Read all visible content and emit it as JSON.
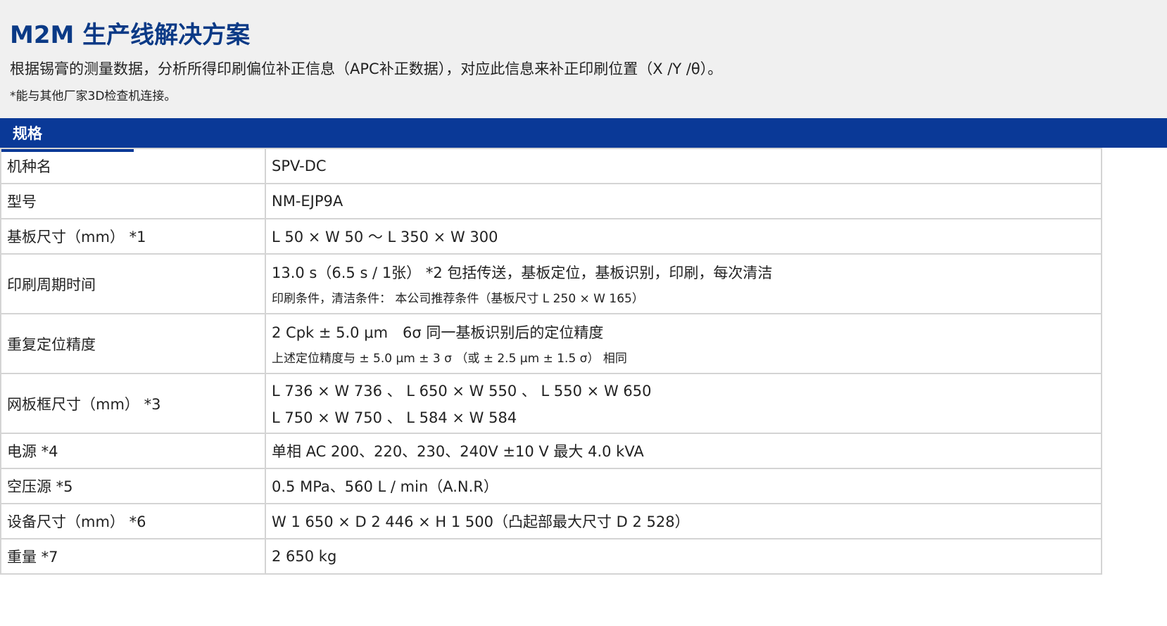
{
  "header": {
    "title": "M2M 生产线解决方案",
    "description": "根据锡膏的测量数据，分析所得印刷偏位补正信息（APC补正数据），对应此信息来补正印刷位置（X /Y /θ）。",
    "note": "*能与其他厂家3D检查机连接。"
  },
  "spec": {
    "tab_label": "规格",
    "rows": [
      {
        "label": "机种名",
        "value": "SPV-DC"
      },
      {
        "label": "型号",
        "value": "NM-EJP9A"
      },
      {
        "label": "基板尺寸（mm） *1",
        "value": "L 50 × W 50 ～ L 350 × W 300"
      },
      {
        "label": "印刷周期时间",
        "value": "13.0 s（6.5 s / 1张） *2 包括传送，基板定位，基板识别，印刷，每次清洁",
        "sub": "印刷条件，清洁条件： 本公司推荐条件（基板尺寸 L 250 × W 165）"
      },
      {
        "label": "重复定位精度",
        "value": "2 Cpk ± 5.0 μm　6σ 同一基板识别后的定位精度",
        "sub": "上述定位精度与 ± 5.0 μm ± 3 σ （或 ± 2.5 μm ± 1.5 σ） 相同"
      },
      {
        "label": "网板框尺寸（mm） *3",
        "value": "L 736 × W 736 、 L 650 × W 550 、 L 550 × W 650",
        "value2": "L 750 × W 750 、 L 584 × W 584"
      },
      {
        "label": "电源 *4",
        "value": "单相 AC 200、220、230、240V ±10 V 最大 4.0 kVA"
      },
      {
        "label": "空压源 *5",
        "value": "0.5 MPa、560 L / min（A.N.R）"
      },
      {
        "label": "设备尺寸（mm） *6",
        "value": "W 1 650 × D 2 446 × H 1 500（凸起部最大尺寸 D 2 528）"
      },
      {
        "label": "重量 *7",
        "value": "2 650 kg"
      }
    ]
  },
  "colors": {
    "title": "#0b3a86",
    "bar": "#0a3997",
    "header_bg": "#f0f0f0",
    "border": "#d4d4d4"
  }
}
